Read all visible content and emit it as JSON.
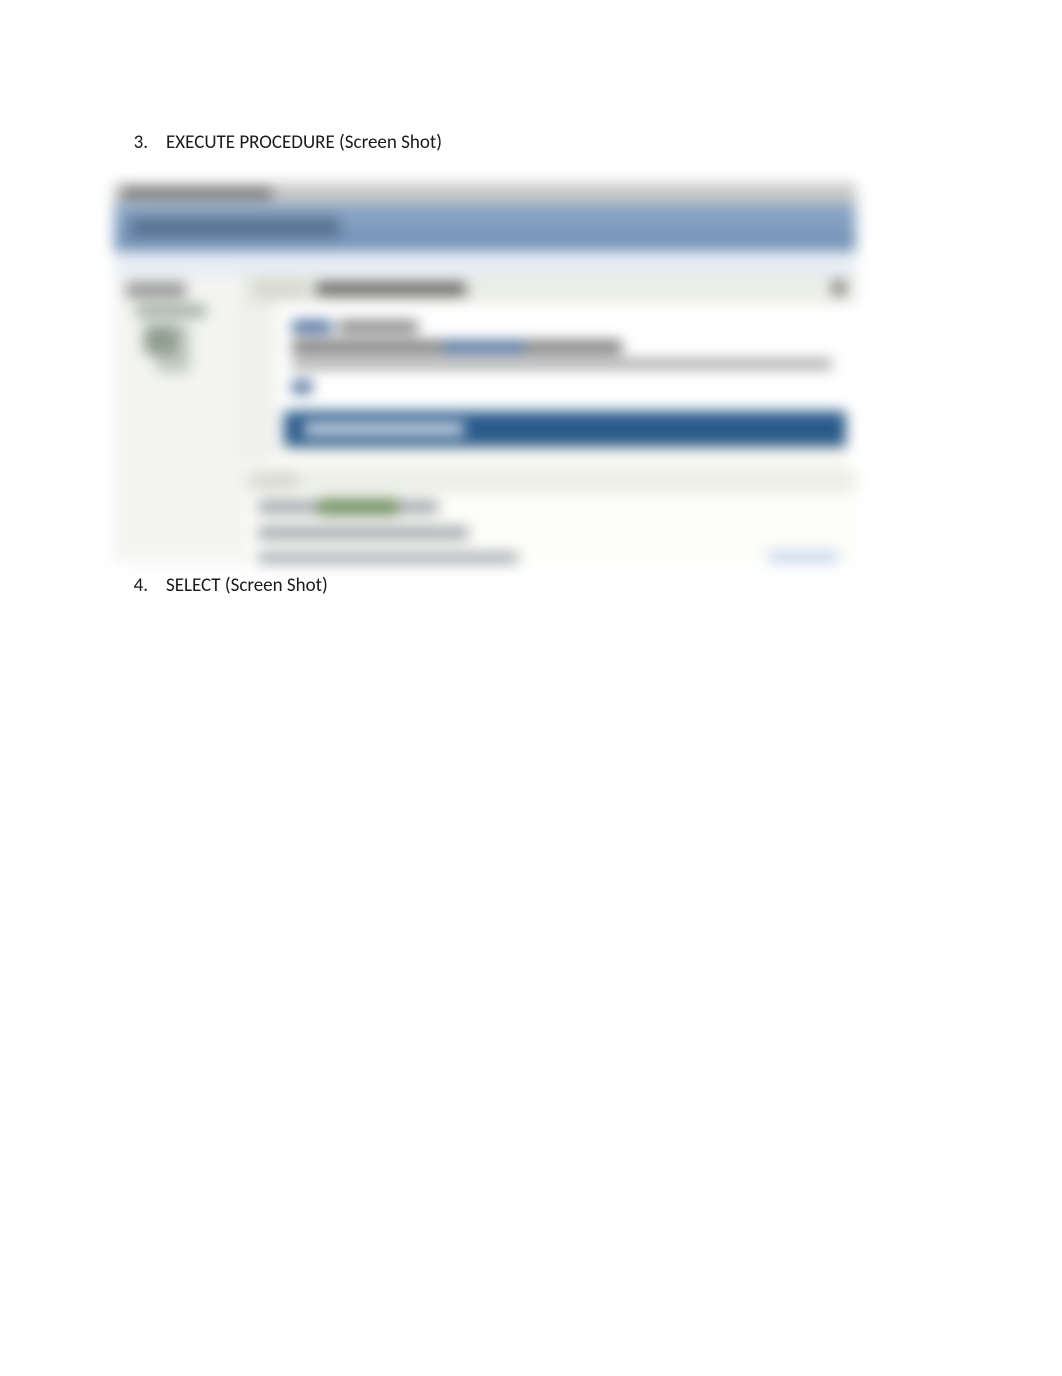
{
  "items": [
    {
      "number": "3.",
      "text": "EXECUTE PROCEDURE (Screen Shot)"
    },
    {
      "number": "4.",
      "text": "SELECT (Screen Shot)"
    }
  ]
}
